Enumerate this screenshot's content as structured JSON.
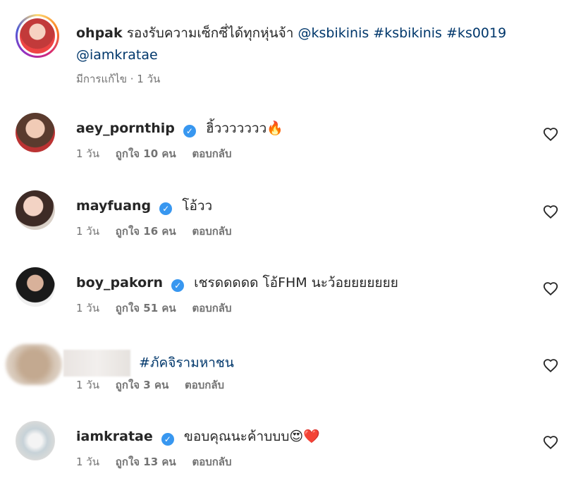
{
  "caption": {
    "username": "ohpak",
    "text": "รองรับความเซ็กซี่ได้ทุกหุ่นจ้า",
    "links": [
      "@ksbikinis",
      "#ksbikinis",
      "#ks0019",
      "@iamkratae"
    ],
    "meta": "มีการแก้ไข · 1 วัน"
  },
  "comments": [
    {
      "username": "aey_pornthip",
      "verified": true,
      "text": "ฮิ้ววววววว",
      "emoji": "🔥",
      "time": "1 วัน",
      "likes": "ถูกใจ 10 คน",
      "reply": "ตอบกลับ"
    },
    {
      "username": "mayfuang",
      "verified": true,
      "text": "โอ้วว",
      "emoji": "",
      "time": "1 วัน",
      "likes": "ถูกใจ 16 คน",
      "reply": "ตอบกลับ"
    },
    {
      "username": "boy_pakorn",
      "verified": true,
      "text": "เชรดดดดด โอ้FHM นะว้อยยยยยยย",
      "emoji": "",
      "time": "1 วัน",
      "likes": "ถูกใจ 51 คน",
      "reply": "ตอบกลับ"
    },
    {
      "username": "",
      "verified": false,
      "text": "#ภัคจิรามหาชน",
      "emoji": "",
      "time": "1 วัน",
      "likes": "ถูกใจ 3 คน",
      "reply": "ตอบกลับ"
    },
    {
      "username": "iamkratae",
      "verified": true,
      "text": "ขอบคุณนะค้าบบบ",
      "emoji": "😍❤️",
      "time": "1 วัน",
      "likes": "ถูกใจ 13 คน",
      "reply": "ตอบกลับ"
    }
  ],
  "icons": {
    "like": "heart-outline-icon",
    "verified": "verified-badge-icon"
  },
  "colors": {
    "link": "#00376b",
    "meta": "#737373",
    "verified": "#3897f0"
  }
}
